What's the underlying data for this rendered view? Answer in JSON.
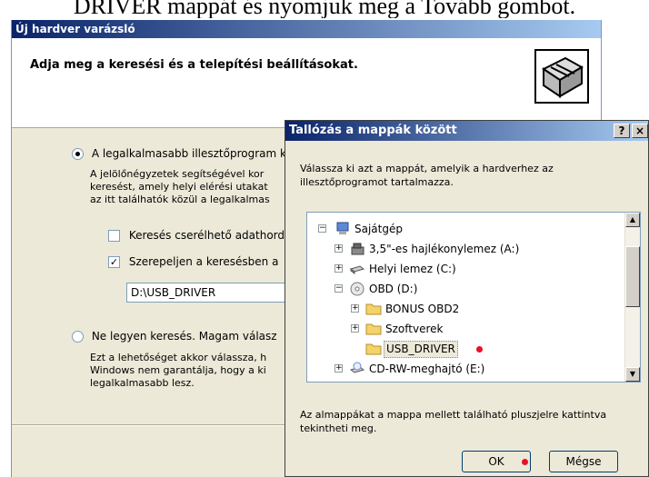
{
  "caption": "DRIVER mappát és nyomjuk meg a Tovább gombot.",
  "wizard": {
    "title": "Új hardver varázsló",
    "heading": "Adja meg a keresési és a telepítési beállításokat.",
    "option1_label": "A legalkalmasabb illesztőprogram k",
    "option1_desc": [
      "A jelölőnégyzetek segítségével kor",
      "keresést, amely helyi elérési utakat",
      "az itt találhatók közül a legalkalmas"
    ],
    "check1_label": "Keresés cserélhető adathord",
    "check2_label": "Szerepeljen a keresésben a",
    "path_value": "D:\\USB_DRIVER",
    "option2_label": "Ne legyen keresés. Magam válasz",
    "option2_desc": [
      "Ezt a lehetőséget akkor válassza, h",
      "Windows nem garantálja, hogy a ki",
      "legalkalmasabb lesz."
    ]
  },
  "dialog": {
    "title": "Tallózás a mappák között",
    "help_btn": "?",
    "close_btn": "×",
    "description": "Válassza ki azt a mappát, amelyik a hardverhez az illesztőprogramot tartalmazza.",
    "tree": [
      {
        "label": "Sajátgép",
        "icon": "computer-icon",
        "exp": "−"
      },
      {
        "label": "3,5\"-es hajlékonylemez (A:)",
        "icon": "floppy-icon",
        "exp": "+"
      },
      {
        "label": "Helyi lemez (C:)",
        "icon": "harddisk-icon",
        "exp": "+"
      },
      {
        "label": "OBD (D:)",
        "icon": "cd-icon",
        "exp": "−"
      },
      {
        "label": "BONUS OBD2",
        "icon": "folder-icon",
        "exp": "+"
      },
      {
        "label": "Szoftverek",
        "icon": "folder-icon",
        "exp": "+"
      },
      {
        "label": "USB_DRIVER",
        "icon": "folder-icon",
        "exp": ""
      },
      {
        "label": "CD-RW-meghajtó (E:)",
        "icon": "cd-drive-icon",
        "exp": "+"
      }
    ],
    "note": "Az almappákat a mappa mellett található pluszjelre kattintva tekintheti meg.",
    "ok_label": "OK",
    "cancel_label": "Mégse"
  },
  "colors": {
    "marker": "#e8102a",
    "titlebar": "#0a246a"
  }
}
